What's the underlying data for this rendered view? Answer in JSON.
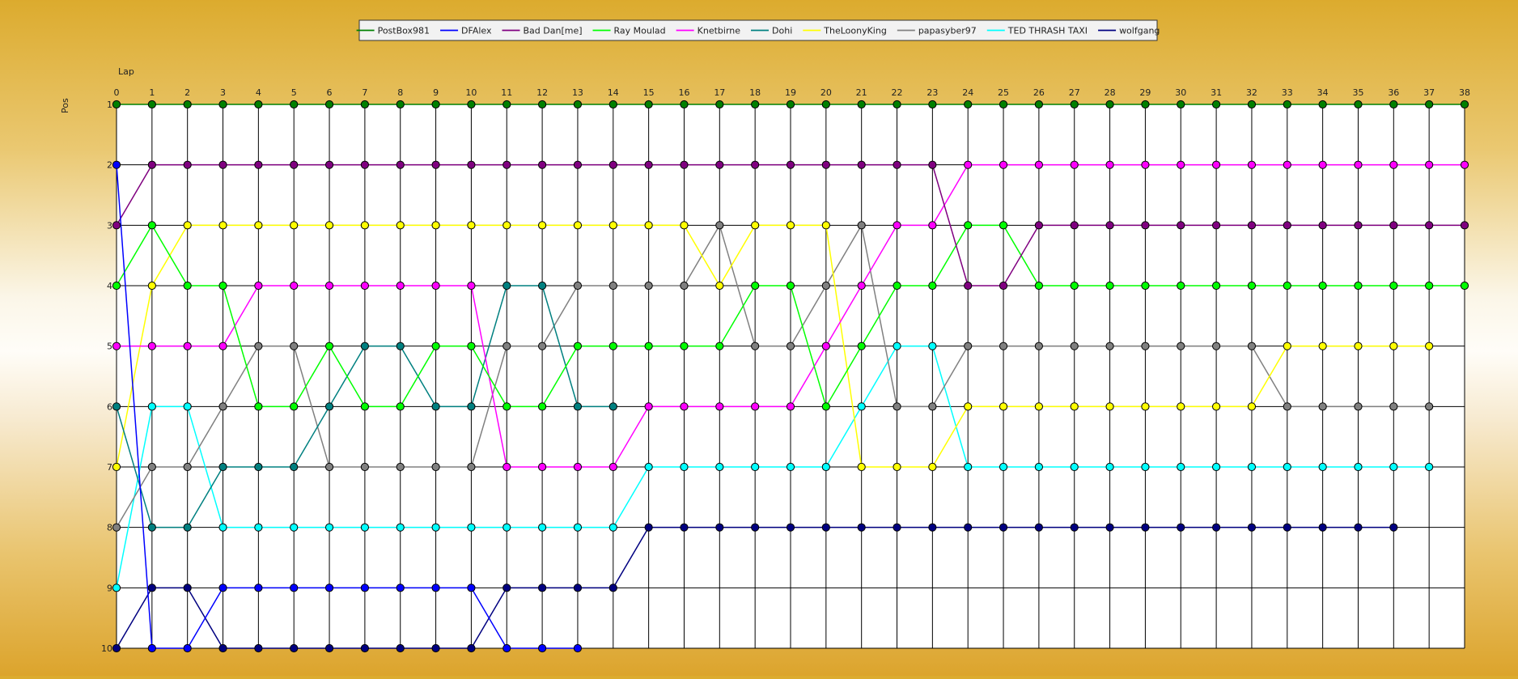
{
  "chart_data": {
    "type": "line",
    "title": "",
    "xlabel": "Lap",
    "ylabel": "Pos",
    "x": [
      0,
      1,
      2,
      3,
      4,
      5,
      6,
      7,
      8,
      9,
      10,
      11,
      12,
      13,
      14,
      15,
      16,
      17,
      18,
      19,
      20,
      21,
      22,
      23,
      24,
      25,
      26,
      27,
      28,
      29,
      30,
      31,
      32,
      33,
      34,
      35,
      36,
      37,
      38
    ],
    "y_categories": [
      1,
      2,
      3,
      4,
      5,
      6,
      7,
      8,
      9,
      10
    ],
    "y_reversed": true,
    "xlim": [
      0,
      38
    ],
    "ylim": [
      1,
      10
    ],
    "grid": true,
    "legend_position": "top-center",
    "series": [
      {
        "name": "PostBox981",
        "color": "#008000",
        "values": [
          1,
          1,
          1,
          1,
          1,
          1,
          1,
          1,
          1,
          1,
          1,
          1,
          1,
          1,
          1,
          1,
          1,
          1,
          1,
          1,
          1,
          1,
          1,
          1,
          1,
          1,
          1,
          1,
          1,
          1,
          1,
          1,
          1,
          1,
          1,
          1,
          1,
          1,
          1
        ]
      },
      {
        "name": "DFAlex",
        "color": "#0000ff",
        "values": [
          2,
          10,
          10,
          9,
          9,
          9,
          9,
          9,
          9,
          9,
          9,
          10,
          10,
          10,
          null,
          null,
          null,
          null,
          null,
          null,
          null,
          null,
          null,
          null,
          null,
          null,
          null,
          null,
          null,
          null,
          null,
          null,
          null,
          null,
          null,
          null,
          null,
          null,
          null
        ]
      },
      {
        "name": "Bad Dan[me]",
        "color": "#800080",
        "values": [
          3,
          2,
          2,
          2,
          2,
          2,
          2,
          2,
          2,
          2,
          2,
          2,
          2,
          2,
          2,
          2,
          2,
          2,
          2,
          2,
          2,
          2,
          2,
          2,
          4,
          4,
          3,
          3,
          3,
          3,
          3,
          3,
          3,
          3,
          3,
          3,
          3,
          3,
          3
        ]
      },
      {
        "name": "Ray Moulad",
        "color": "#00ff00",
        "values": [
          4,
          3,
          4,
          4,
          6,
          6,
          5,
          6,
          6,
          5,
          5,
          6,
          6,
          5,
          5,
          5,
          5,
          5,
          4,
          4,
          6,
          5,
          4,
          4,
          3,
          3,
          4,
          4,
          4,
          4,
          4,
          4,
          4,
          4,
          4,
          4,
          4,
          4,
          4
        ]
      },
      {
        "name": "Knetbirne",
        "color": "#ff00ff",
        "values": [
          5,
          5,
          5,
          5,
          4,
          4,
          4,
          4,
          4,
          4,
          4,
          7,
          7,
          7,
          7,
          6,
          6,
          6,
          6,
          6,
          5,
          4,
          3,
          3,
          2,
          2,
          2,
          2,
          2,
          2,
          2,
          2,
          2,
          2,
          2,
          2,
          2,
          2,
          2
        ]
      },
      {
        "name": "Dohi",
        "color": "#008080",
        "values": [
          6,
          8,
          8,
          7,
          7,
          7,
          6,
          5,
          5,
          6,
          6,
          4,
          4,
          6,
          6,
          null,
          null,
          null,
          null,
          null,
          null,
          null,
          null,
          null,
          null,
          null,
          null,
          null,
          null,
          null,
          null,
          null,
          null,
          null,
          null,
          null,
          null,
          null,
          null
        ]
      },
      {
        "name": "TheLoonyKing",
        "color": "#ffff00",
        "values": [
          7,
          4,
          3,
          3,
          3,
          3,
          3,
          3,
          3,
          3,
          3,
          3,
          3,
          3,
          3,
          3,
          3,
          4,
          3,
          3,
          3,
          7,
          7,
          7,
          6,
          6,
          6,
          6,
          6,
          6,
          6,
          6,
          6,
          5,
          5,
          5,
          5,
          5,
          null
        ]
      },
      {
        "name": "papasyber97",
        "color": "#808080",
        "values": [
          8,
          7,
          7,
          6,
          5,
          5,
          7,
          7,
          7,
          7,
          7,
          5,
          5,
          4,
          4,
          4,
          4,
          3,
          5,
          5,
          4,
          3,
          6,
          6,
          5,
          5,
          5,
          5,
          5,
          5,
          5,
          5,
          5,
          6,
          6,
          6,
          6,
          6,
          null
        ]
      },
      {
        "name": "TED THRASH TAXI",
        "color": "#00ffff",
        "values": [
          9,
          6,
          6,
          8,
          8,
          8,
          8,
          8,
          8,
          8,
          8,
          8,
          8,
          8,
          8,
          7,
          7,
          7,
          7,
          7,
          7,
          6,
          5,
          5,
          7,
          7,
          7,
          7,
          7,
          7,
          7,
          7,
          7,
          7,
          7,
          7,
          7,
          7,
          null
        ]
      },
      {
        "name": "wolfgang",
        "color": "#000080",
        "values": [
          10,
          9,
          9,
          10,
          10,
          10,
          10,
          10,
          10,
          10,
          10,
          9,
          9,
          9,
          9,
          8,
          8,
          8,
          8,
          8,
          8,
          8,
          8,
          8,
          8,
          8,
          8,
          8,
          8,
          8,
          8,
          8,
          8,
          8,
          8,
          8,
          8,
          null,
          null
        ]
      }
    ]
  }
}
